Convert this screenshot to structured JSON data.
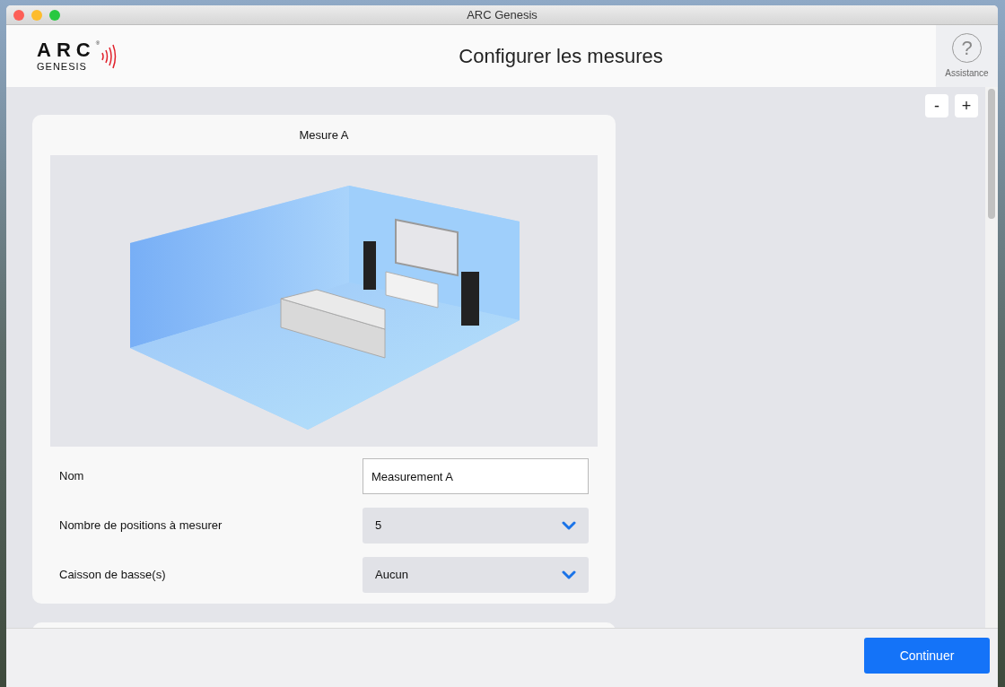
{
  "window": {
    "title": "ARC Genesis"
  },
  "logo": {
    "wordmark": "ARC",
    "registered": "®",
    "subtitle": "GENESIS"
  },
  "header": {
    "title": "Configurer les mesures"
  },
  "assistance": {
    "icon": "?",
    "label": "Assistance"
  },
  "zoom_buttons": [
    "-",
    "+"
  ],
  "measurement": {
    "title": "Mesure A",
    "fields": [
      {
        "kind": "text",
        "label": "Nom",
        "value": "Measurement A"
      },
      {
        "kind": "select",
        "label": "Nombre de positions à mesurer",
        "value": "5"
      },
      {
        "kind": "select",
        "label": "Caisson de basse(s)",
        "value": "Aucun"
      }
    ]
  },
  "footer": {
    "button": "Continuer"
  }
}
